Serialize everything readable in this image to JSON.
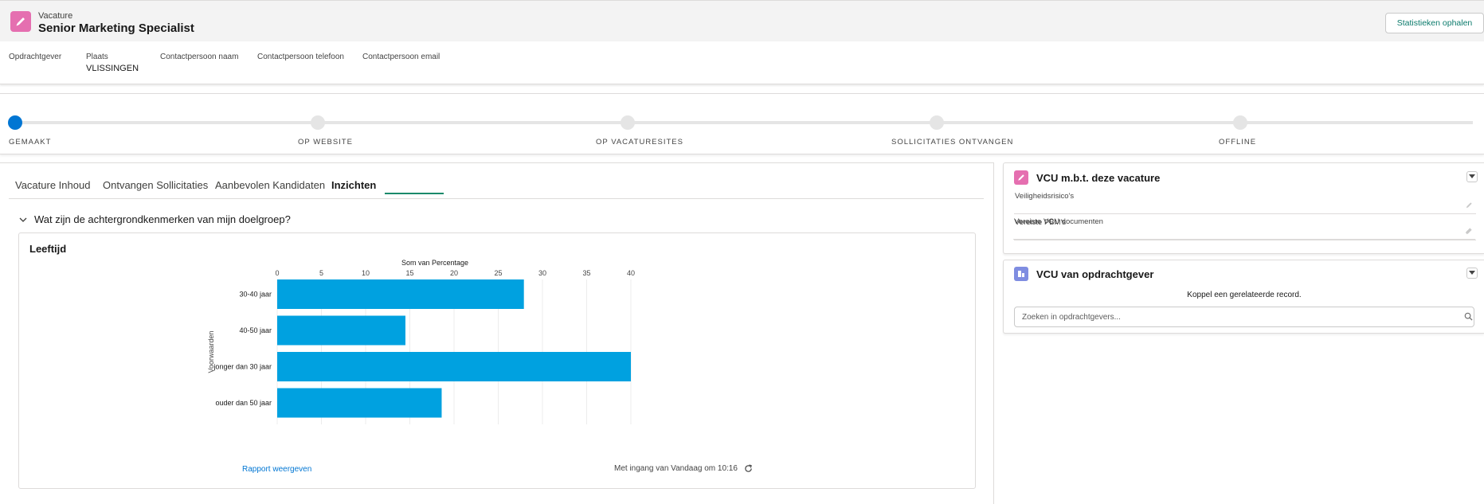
{
  "header": {
    "object_type": "Vacature",
    "title": "Senior Marketing Specialist",
    "stats_button": "Statistieken ophalen",
    "icon": "pencil-icon",
    "icon_color": "#e56fb0"
  },
  "highlights": [
    {
      "label": "Opdrachtgever",
      "value": ""
    },
    {
      "label": "Plaats",
      "value": "VLISSINGEN"
    },
    {
      "label": "Contactpersoon naam",
      "value": ""
    },
    {
      "label": "Contactpersoon telefoon",
      "value": ""
    },
    {
      "label": "Contactpersoon email",
      "value": ""
    }
  ],
  "path": {
    "stages": [
      "GEMAAKT",
      "OP WEBSITE",
      "OP VACATURESITES",
      "SOLLICITATIES ONTVANGEN",
      "OFFLINE"
    ],
    "current_index": 0,
    "active_color": "#0176d3"
  },
  "tabs": [
    {
      "label": "Vacature Inhoud"
    },
    {
      "label": "Ontvangen Sollicitaties"
    },
    {
      "label": "Aanbevolen Kandidaten"
    },
    {
      "label": "Inzichten"
    }
  ],
  "active_tab": "Inzichten",
  "section": {
    "title": "Wat zijn de achtergrondkenmerken van mijn doelgroep?"
  },
  "chart_card": {
    "title": "Leeftijd",
    "report_link": "Rapport weergeven",
    "as_of": "Met ingang van Vandaag om 10:16"
  },
  "chart_data": {
    "type": "bar",
    "orientation": "horizontal",
    "title": "Leeftijd",
    "xlabel": "Som van Percentage",
    "ylabel": "Voorwaarden",
    "xlim": [
      0,
      40
    ],
    "xticks": [
      0,
      5,
      10,
      15,
      20,
      25,
      30,
      35,
      40
    ],
    "categories": [
      "30-40 jaar",
      "40-50 jaar",
      "jonger dan 30 jaar",
      "ouder dan 50 jaar"
    ],
    "values": [
      27.9,
      14.5,
      40,
      18.6
    ],
    "bar_color": "#00a1e0",
    "grid": true
  },
  "right_cards": {
    "vcu_vacature": {
      "title": "VCU m.b.t. deze vacature",
      "icon": "pencil-icon",
      "icon_color": "#e56fb0",
      "fields": [
        {
          "label": "Veiligheidsrisico's",
          "value": ""
        },
        {
          "label": "Vereiste PBM's",
          "value": ""
        },
        {
          "label": "Vereiste VCU documenten",
          "value": ""
        }
      ]
    },
    "vcu_opdrachtgever": {
      "title": "VCU van opdrachtgever",
      "icon": "building-icon",
      "icon_color": "#7f8de1",
      "empty_text": "Koppel een gerelateerde record.",
      "search_placeholder": "Zoeken in opdrachtgevers..."
    }
  }
}
